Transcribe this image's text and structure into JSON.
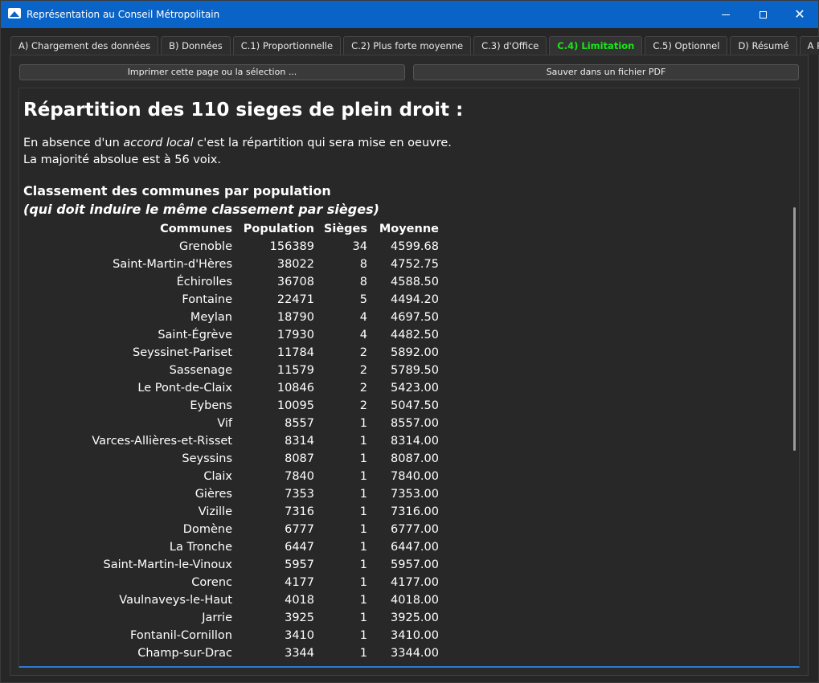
{
  "window": {
    "title": "Représentation au Conseil Métropolitain"
  },
  "tabs": [
    {
      "label": "A) Chargement des données"
    },
    {
      "label": "B) Données"
    },
    {
      "label": "C.1) Proportionnelle"
    },
    {
      "label": "C.2) Plus forte moyenne"
    },
    {
      "label": "C.3) d'Office"
    },
    {
      "label": "C.4) Limitation",
      "active": true
    },
    {
      "label": "C.5) Optionnel"
    },
    {
      "label": "D) Résumé"
    },
    {
      "label": "A Propos"
    }
  ],
  "toolbar": {
    "print_label": "Imprimer cette page ou la sélection ...",
    "pdf_label": "Sauver dans un fichier PDF"
  },
  "content": {
    "heading": "Répartition des 110 sieges de plein droit :",
    "intro_prefix": "En absence d'un ",
    "intro_emphasis": "accord local",
    "intro_suffix": " c'est la répartition qui sera mise en oeuvre.",
    "majority_text": "La majorité absolue est à 56 voix.",
    "section_title": "Classement des communes par population",
    "section_subtitle": "(qui doit induire le même classement par sièges)"
  },
  "table": {
    "headers": [
      "Communes",
      "Population",
      "Sièges",
      "Moyenne"
    ],
    "rows": [
      [
        "Grenoble",
        "156389",
        "34",
        "4599.68"
      ],
      [
        "Saint-Martin-d'Hères",
        "38022",
        "8",
        "4752.75"
      ],
      [
        "Échirolles",
        "36708",
        "8",
        "4588.50"
      ],
      [
        "Fontaine",
        "22471",
        "5",
        "4494.20"
      ],
      [
        "Meylan",
        "18790",
        "4",
        "4697.50"
      ],
      [
        "Saint-Égrève",
        "17930",
        "4",
        "4482.50"
      ],
      [
        "Seyssinet-Pariset",
        "11784",
        "2",
        "5892.00"
      ],
      [
        "Sassenage",
        "11579",
        "2",
        "5789.50"
      ],
      [
        "Le Pont-de-Claix",
        "10846",
        "2",
        "5423.00"
      ],
      [
        "Eybens",
        "10095",
        "2",
        "5047.50"
      ],
      [
        "Vif",
        "8557",
        "1",
        "8557.00"
      ],
      [
        "Varces-Allières-et-Risset",
        "8314",
        "1",
        "8314.00"
      ],
      [
        "Seyssins",
        "8087",
        "1",
        "8087.00"
      ],
      [
        "Claix",
        "7840",
        "1",
        "7840.00"
      ],
      [
        "Gières",
        "7353",
        "1",
        "7353.00"
      ],
      [
        "Vizille",
        "7316",
        "1",
        "7316.00"
      ],
      [
        "Domène",
        "6777",
        "1",
        "6777.00"
      ],
      [
        "La Tronche",
        "6447",
        "1",
        "6447.00"
      ],
      [
        "Saint-Martin-le-Vinoux",
        "5957",
        "1",
        "5957.00"
      ],
      [
        "Corenc",
        "4177",
        "1",
        "4177.00"
      ],
      [
        "Vaulnaveys-le-Haut",
        "4018",
        "1",
        "4018.00"
      ],
      [
        "Jarrie",
        "3925",
        "1",
        "3925.00"
      ],
      [
        "Fontanil-Cornillon",
        "3410",
        "1",
        "3410.00"
      ],
      [
        "Champ-sur-Drac",
        "3344",
        "1",
        "3344.00"
      ]
    ]
  },
  "icons": {
    "app": "app-logo-icon",
    "minimize": "minimize-icon",
    "maximize": "maximize-icon",
    "close": "close-icon"
  },
  "colors": {
    "titlebar": "#0a64c8",
    "active_tab_text": "#19e619",
    "focus_border": "#2f7ad0"
  }
}
